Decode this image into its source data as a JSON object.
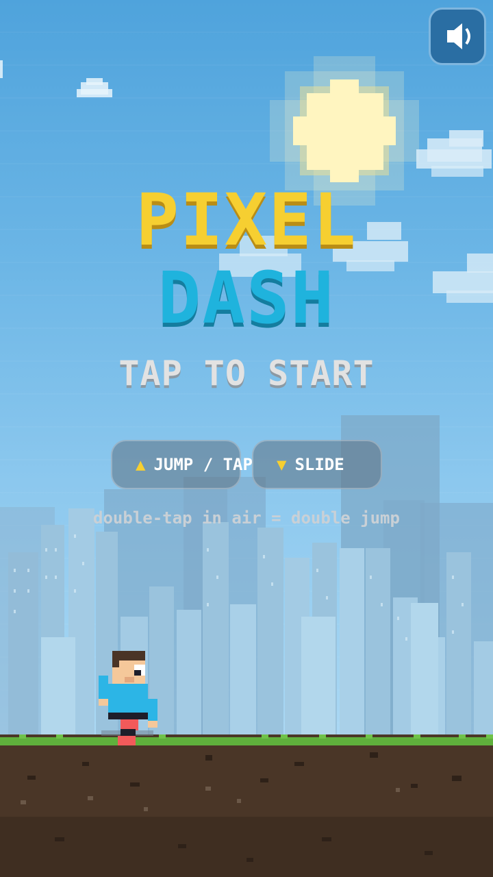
{
  "game": {
    "title_line1": "PIXEL",
    "title_line2": "DASH",
    "start_prompt": "TAP TO START"
  },
  "controls": {
    "jump": {
      "icon": "up-triangle-icon",
      "label": "JUMP / TAP"
    },
    "slide": {
      "icon": "down-triangle-icon",
      "label": "SLIDE"
    },
    "hint": "double-tap in air = double jump"
  },
  "sound": {
    "icon": "speaker-icon",
    "state": "on"
  },
  "colors": {
    "title_yellow": "#f6cf31",
    "title_blue": "#1fb3dd",
    "sky": "#6cb6e6",
    "grass": "#5fb03c",
    "dirt": "#4d3828",
    "runner_shirt": "#2cb5e6",
    "runner_shoes": "#f25a5a"
  }
}
